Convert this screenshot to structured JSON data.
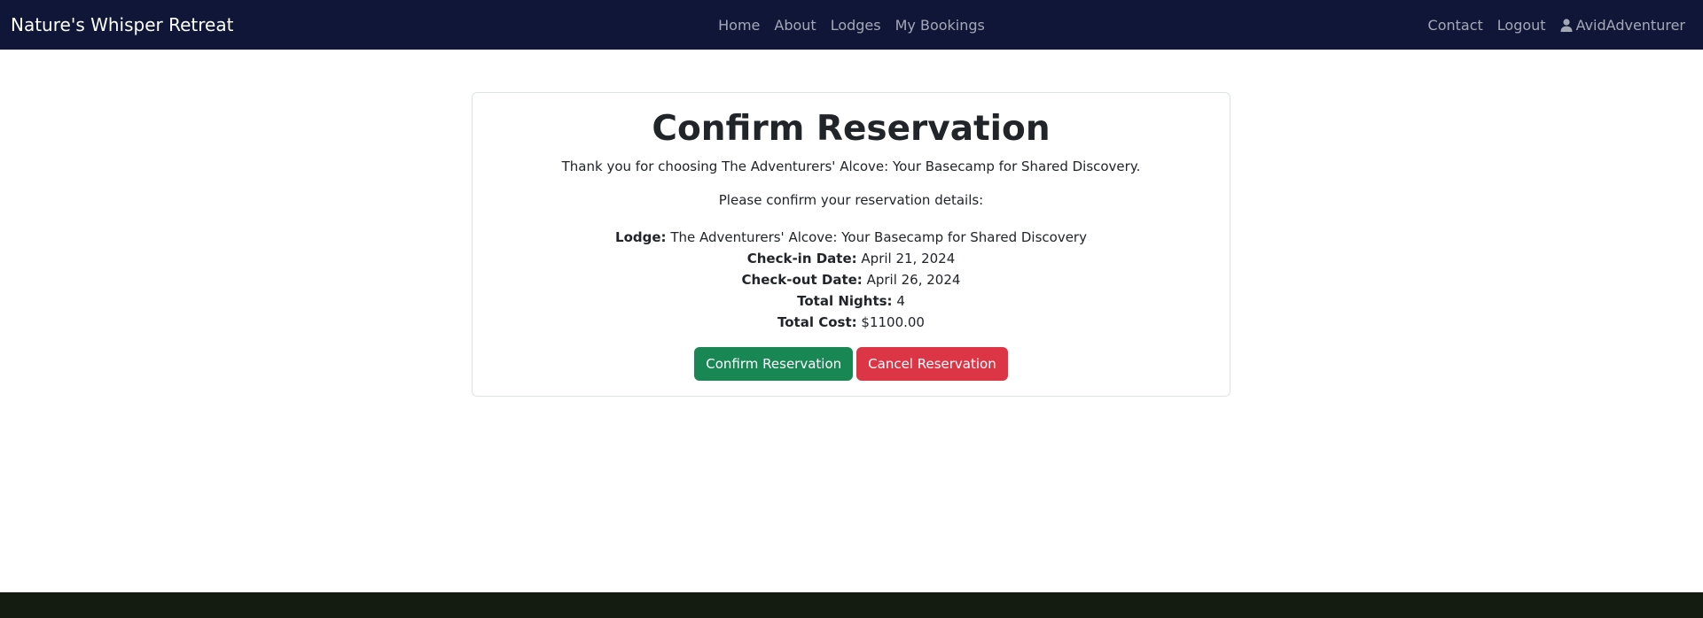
{
  "navbar": {
    "brand": "Nature's Whisper Retreat",
    "links": [
      "Home",
      "About",
      "Lodges",
      "My Bookings"
    ],
    "right_links": [
      "Contact",
      "Logout"
    ],
    "user": {
      "name": "AvidAdventurer",
      "icon": "user-icon"
    },
    "background": "#0f1638"
  },
  "main": {
    "title": "Confirm Reservation",
    "thanks_text": "Thank you for choosing The Adventurers' Alcove: Your Basecamp for Shared Discovery.",
    "prompt_text": "Please confirm your reservation details:",
    "details": [
      {
        "label": "Lodge:",
        "value": "The Adventurers' Alcove: Your Basecamp for Shared Discovery"
      },
      {
        "label": "Check-in Date:",
        "value": "April 21, 2024"
      },
      {
        "label": "Check-out Date:",
        "value": "April 26, 2024"
      },
      {
        "label": "Total Nights:",
        "value": "4"
      },
      {
        "label": "Total Cost:",
        "value": "$1100.00"
      }
    ],
    "confirm_label": "Confirm Reservation",
    "cancel_label": "Cancel Reservation"
  },
  "colors": {
    "confirm": "#198754",
    "cancel": "#dc3545",
    "footer": "#141c11"
  }
}
